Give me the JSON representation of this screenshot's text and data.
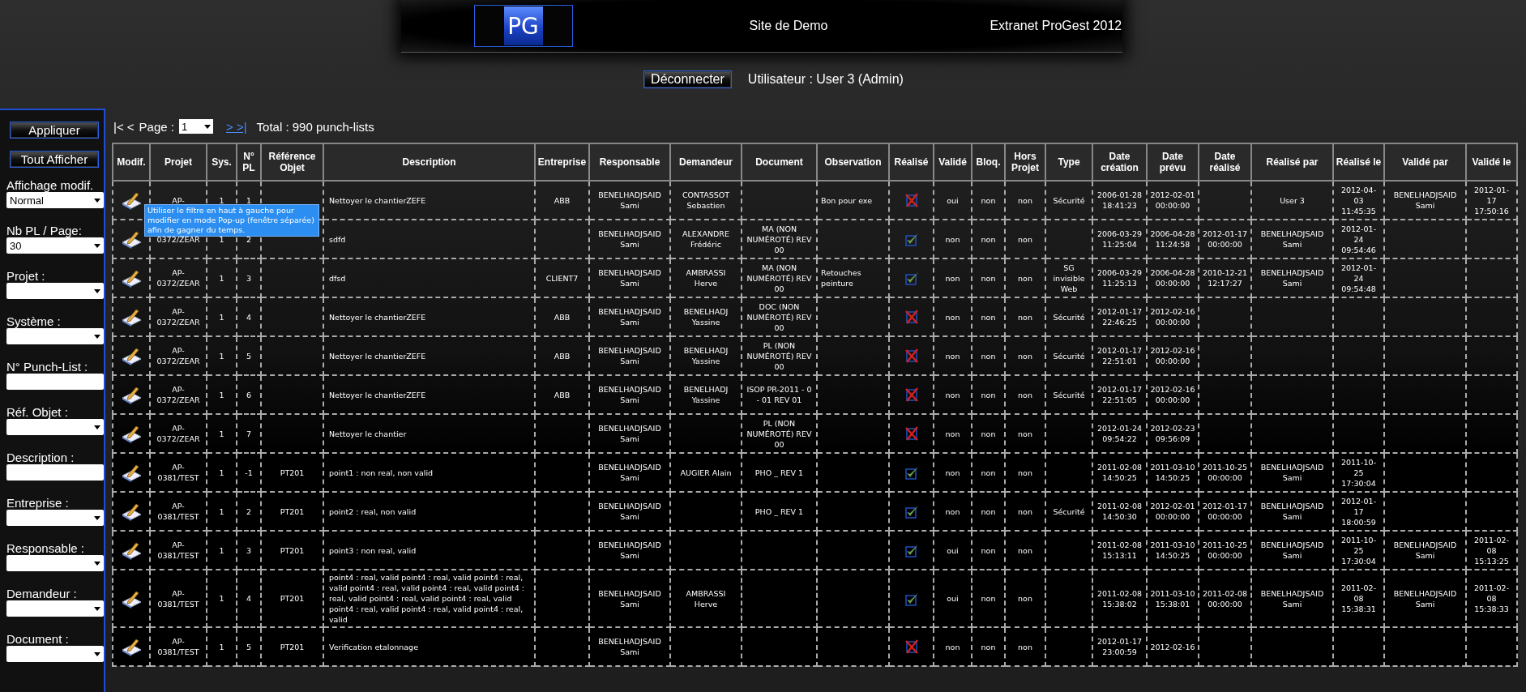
{
  "header": {
    "logo": "PG",
    "site": "Site de Demo",
    "product": "Extranet ProGest 2012"
  },
  "user_bar": {
    "logout_button": "Déconnecter",
    "user": "Utilisateur : User 3  (Admin)"
  },
  "sidebar": {
    "buttons": [
      "Appliquer",
      "Tout Afficher"
    ],
    "filters": [
      {
        "label": "Affichage modif.",
        "kind": "select",
        "value": "Normal"
      },
      {
        "label": "Nb PL / Page:",
        "kind": "select",
        "value": "30"
      },
      {
        "label": "Projet :",
        "kind": "select"
      },
      {
        "label": "Système :",
        "kind": "select"
      },
      {
        "label": "N° Punch-List :",
        "kind": "input"
      },
      {
        "label": "Réf. Objet :",
        "kind": "select"
      },
      {
        "label": "Description :",
        "kind": "input"
      },
      {
        "label": "Entreprise :",
        "kind": "select"
      },
      {
        "label": "Responsable :",
        "kind": "select"
      },
      {
        "label": "Demandeur :",
        "kind": "select"
      },
      {
        "label": "Document :",
        "kind": "select"
      }
    ]
  },
  "pagination": {
    "first_prev": "|< <",
    "page_label": "Page :",
    "page": "1",
    "next_last": "> >|",
    "total": "Total : 990 punch-lists"
  },
  "tooltip": "Utiliser le filtre en haut à gauche pour modifier en mode Pop-up (fenêtre séparée) afin de gagner du temps.",
  "table": {
    "columns": [
      "Modif.",
      "Projet",
      "Sys.",
      "N° PL",
      "Référence Objet",
      "Description",
      "Entreprise",
      "Responsable",
      "Demandeur",
      "Document",
      "Observation",
      "Réalisé",
      "Validé",
      "Bloq.",
      "Hors Projet",
      "Type",
      "Date création",
      "Date prévu",
      "Date réalisé",
      "Réalisé par",
      "Réalisé le",
      "Validé par",
      "Validé le"
    ],
    "rows": [
      {
        "projet": "AP-",
        "sys": "1",
        "no_pl": "1",
        "description": "Nettoyer le chantierZEFE",
        "entreprise": "ABB",
        "responsable": "BENELHADJSAID Sami",
        "demandeur": "CONTASSOT Sebastien",
        "observation": "Bon pour exe",
        "done": false,
        "valide": "oui",
        "bloque": "non",
        "hors_projet": "non",
        "type": "Sécurité",
        "date_creation": "2006-01-28 18:41:23",
        "date_prevu": "2012-02-01 00:00:00",
        "realise_par": "User 3",
        "realise_le": "2012-04-03 11:45:35",
        "valide_par": "BENELHADJSAID Sami",
        "valide_le": "2012-01-17 17:50:16"
      },
      {
        "projet": "0372/ZEAR",
        "sys": "1",
        "no_pl": "2",
        "description": "sdfd",
        "responsable": "BENELHADJSAID Sami",
        "demandeur": "ALEXANDRE Frédéric",
        "document": "MA (NON NUMÉROTÉ) REV 00",
        "done": true,
        "valide": "non",
        "bloque": "non",
        "hors_projet": "non",
        "date_creation": "2006-03-29 11:25:04",
        "date_prevu": "2006-04-28 11:24:58",
        "date_realise": "2012-01-17 00:00:00",
        "realise_par": "BENELHADJSAID Sami",
        "realise_le": "2012-01-24 09:54:46"
      },
      {
        "projet": "AP-0372/ZEAR",
        "sys": "1",
        "no_pl": "3",
        "description": "dfsd",
        "entreprise": "CLIENT7",
        "responsable": "BENELHADJSAID Sami",
        "demandeur": "AMBRASSI Herve",
        "document": "MA (NON NUMÉROTÉ) REV 00",
        "observation": "Retouches peinture",
        "done": true,
        "valide": "non",
        "bloque": "non",
        "hors_projet": "non",
        "type": "SG invisible Web",
        "date_creation": "2006-03-29 11:25:13",
        "date_prevu": "2006-04-28 00:00:00",
        "date_realise": "2010-12-21 12:17:27",
        "realise_par": "BENELHADJSAID Sami",
        "realise_le": "2012-01-24 09:54:48"
      },
      {
        "projet": "AP-0372/ZEAR",
        "sys": "1",
        "no_pl": "4",
        "description": "Nettoyer le chantierZEFE",
        "entreprise": "ABB",
        "responsable": "BENELHADJSAID Sami",
        "demandeur": "BENELHADJ Yassine",
        "document": "DOC (NON NUMÉROTÉ) REV 00",
        "done": false,
        "valide": "non",
        "bloque": "non",
        "hors_projet": "non",
        "type": "Sécurité",
        "date_creation": "2012-01-17 22:46:25",
        "date_prevu": "2012-02-16 00:00:00"
      },
      {
        "projet": "AP-0372/ZEAR",
        "sys": "1",
        "no_pl": "5",
        "description": "Nettoyer le chantierZEFE",
        "entreprise": "ABB",
        "responsable": "BENELHADJSAID Sami",
        "demandeur": "BENELHADJ Yassine",
        "document": "PL (NON NUMÉROTÉ) REV 00",
        "done": false,
        "valide": "non",
        "bloque": "non",
        "hors_projet": "non",
        "type": "Sécurité",
        "date_creation": "2012-01-17 22:51:01",
        "date_prevu": "2012-02-16 00:00:00"
      },
      {
        "projet": "AP-0372/ZEAR",
        "sys": "1",
        "no_pl": "6",
        "description": "Nettoyer le chantierZEFE",
        "entreprise": "ABB",
        "responsable": "BENELHADJSAID Sami",
        "demandeur": "BENELHADJ Yassine",
        "document": "ISOP PR-2011 - 0 - 01 REV 01",
        "done": false,
        "valide": "non",
        "bloque": "non",
        "hors_projet": "non",
        "type": "Sécurité",
        "date_creation": "2012-01-17 22:51:05",
        "date_prevu": "2012-02-16 00:00:00"
      },
      {
        "projet": "AP-0372/ZEAR",
        "sys": "1",
        "no_pl": "7",
        "description": "Nettoyer le chantier",
        "responsable": "BENELHADJSAID Sami",
        "document": "PL (NON NUMÉROTÉ) REV 00",
        "done": false,
        "valide": "non",
        "bloque": "non",
        "hors_projet": "non",
        "date_creation": "2012-01-24 09:54:22",
        "date_prevu": "2012-02-23 09:56:09"
      },
      {
        "projet": "AP-0381/TEST",
        "sys": "1",
        "no_pl": "-1",
        "reference": "PT201",
        "description": "point1 : non real, non valid",
        "responsable": "BENELHADJSAID Sami",
        "demandeur": "AUGIER Alain",
        "document": "PHO _ REV 1",
        "done": true,
        "valide": "non",
        "bloque": "non",
        "hors_projet": "non",
        "date_creation": "2011-02-08 14:50:25",
        "date_prevu": "2011-03-10 14:50:25",
        "date_realise": "2011-10-25 00:00:00",
        "realise_par": "BENELHADJSAID Sami",
        "realise_le": "2011-10-25 17:30:04"
      },
      {
        "projet": "AP-0381/TEST",
        "sys": "1",
        "no_pl": "2",
        "reference": "PT201",
        "description": "point2 : real, non valid",
        "responsable": "BENELHADJSAID Sami",
        "document": "PHO _ REV 1",
        "done": true,
        "valide": "non",
        "bloque": "non",
        "hors_projet": "non",
        "type": "Sécurité",
        "date_creation": "2011-02-08 14:50:30",
        "date_prevu": "2012-02-01 00:00:00",
        "date_realise": "2012-01-17 00:00:00",
        "realise_par": "BENELHADJSAID Sami",
        "realise_le": "2012-01-17 18:00:59"
      },
      {
        "projet": "AP-0381/TEST",
        "sys": "1",
        "no_pl": "3",
        "reference": "PT201",
        "description": "point3 : non real, valid",
        "responsable": "BENELHADJSAID Sami",
        "done": true,
        "valide": "oui",
        "bloque": "non",
        "hors_projet": "non",
        "date_creation": "2011-02-08 15:13:11",
        "date_prevu": "2011-03-10 14:50:25",
        "date_realise": "2011-10-25 00:00:00",
        "realise_par": "BENELHADJSAID Sami",
        "realise_le": "2011-10-25 17:30:04",
        "valide_par": "BENELHADJSAID Sami",
        "valide_le": "2011-02-08 15:13:25"
      },
      {
        "projet": "AP-0381/TEST",
        "sys": "1",
        "no_pl": "4",
        "reference": "PT201",
        "description": "point4 : real, valid point4 : real, valid point4 : real, valid point4 : real, valid point4 : real, valid point4 : real, valid point4 : real, valid point4 : real, valid point4 : real, valid point4 : real, valid point4 : real, valid",
        "responsable": "BENELHADJSAID Sami",
        "demandeur": "AMBRASSI Herve",
        "done": true,
        "valide": "oui",
        "bloque": "non",
        "hors_projet": "non",
        "date_creation": "2011-02-08 15:38:02",
        "date_prevu": "2011-03-10 15:38:01",
        "date_realise": "2011-02-08 00:00:00",
        "realise_par": "BENELHADJSAID Sami",
        "realise_le": "2011-02-08 15:38:31",
        "valide_par": "BENELHADJSAID Sami",
        "valide_le": "2011-02-08 15:38:33"
      },
      {
        "projet": "AP-0381/TEST",
        "sys": "1",
        "no_pl": "5",
        "reference": "PT201",
        "description": "Verification etalonnage",
        "responsable": "BENELHADJSAID Sami",
        "done": false,
        "valide": "non",
        "bloque": "non",
        "hors_projet": "non",
        "date_creation": "2012-01-17 23:00:59",
        "date_prevu": "2012-02-16"
      }
    ]
  }
}
